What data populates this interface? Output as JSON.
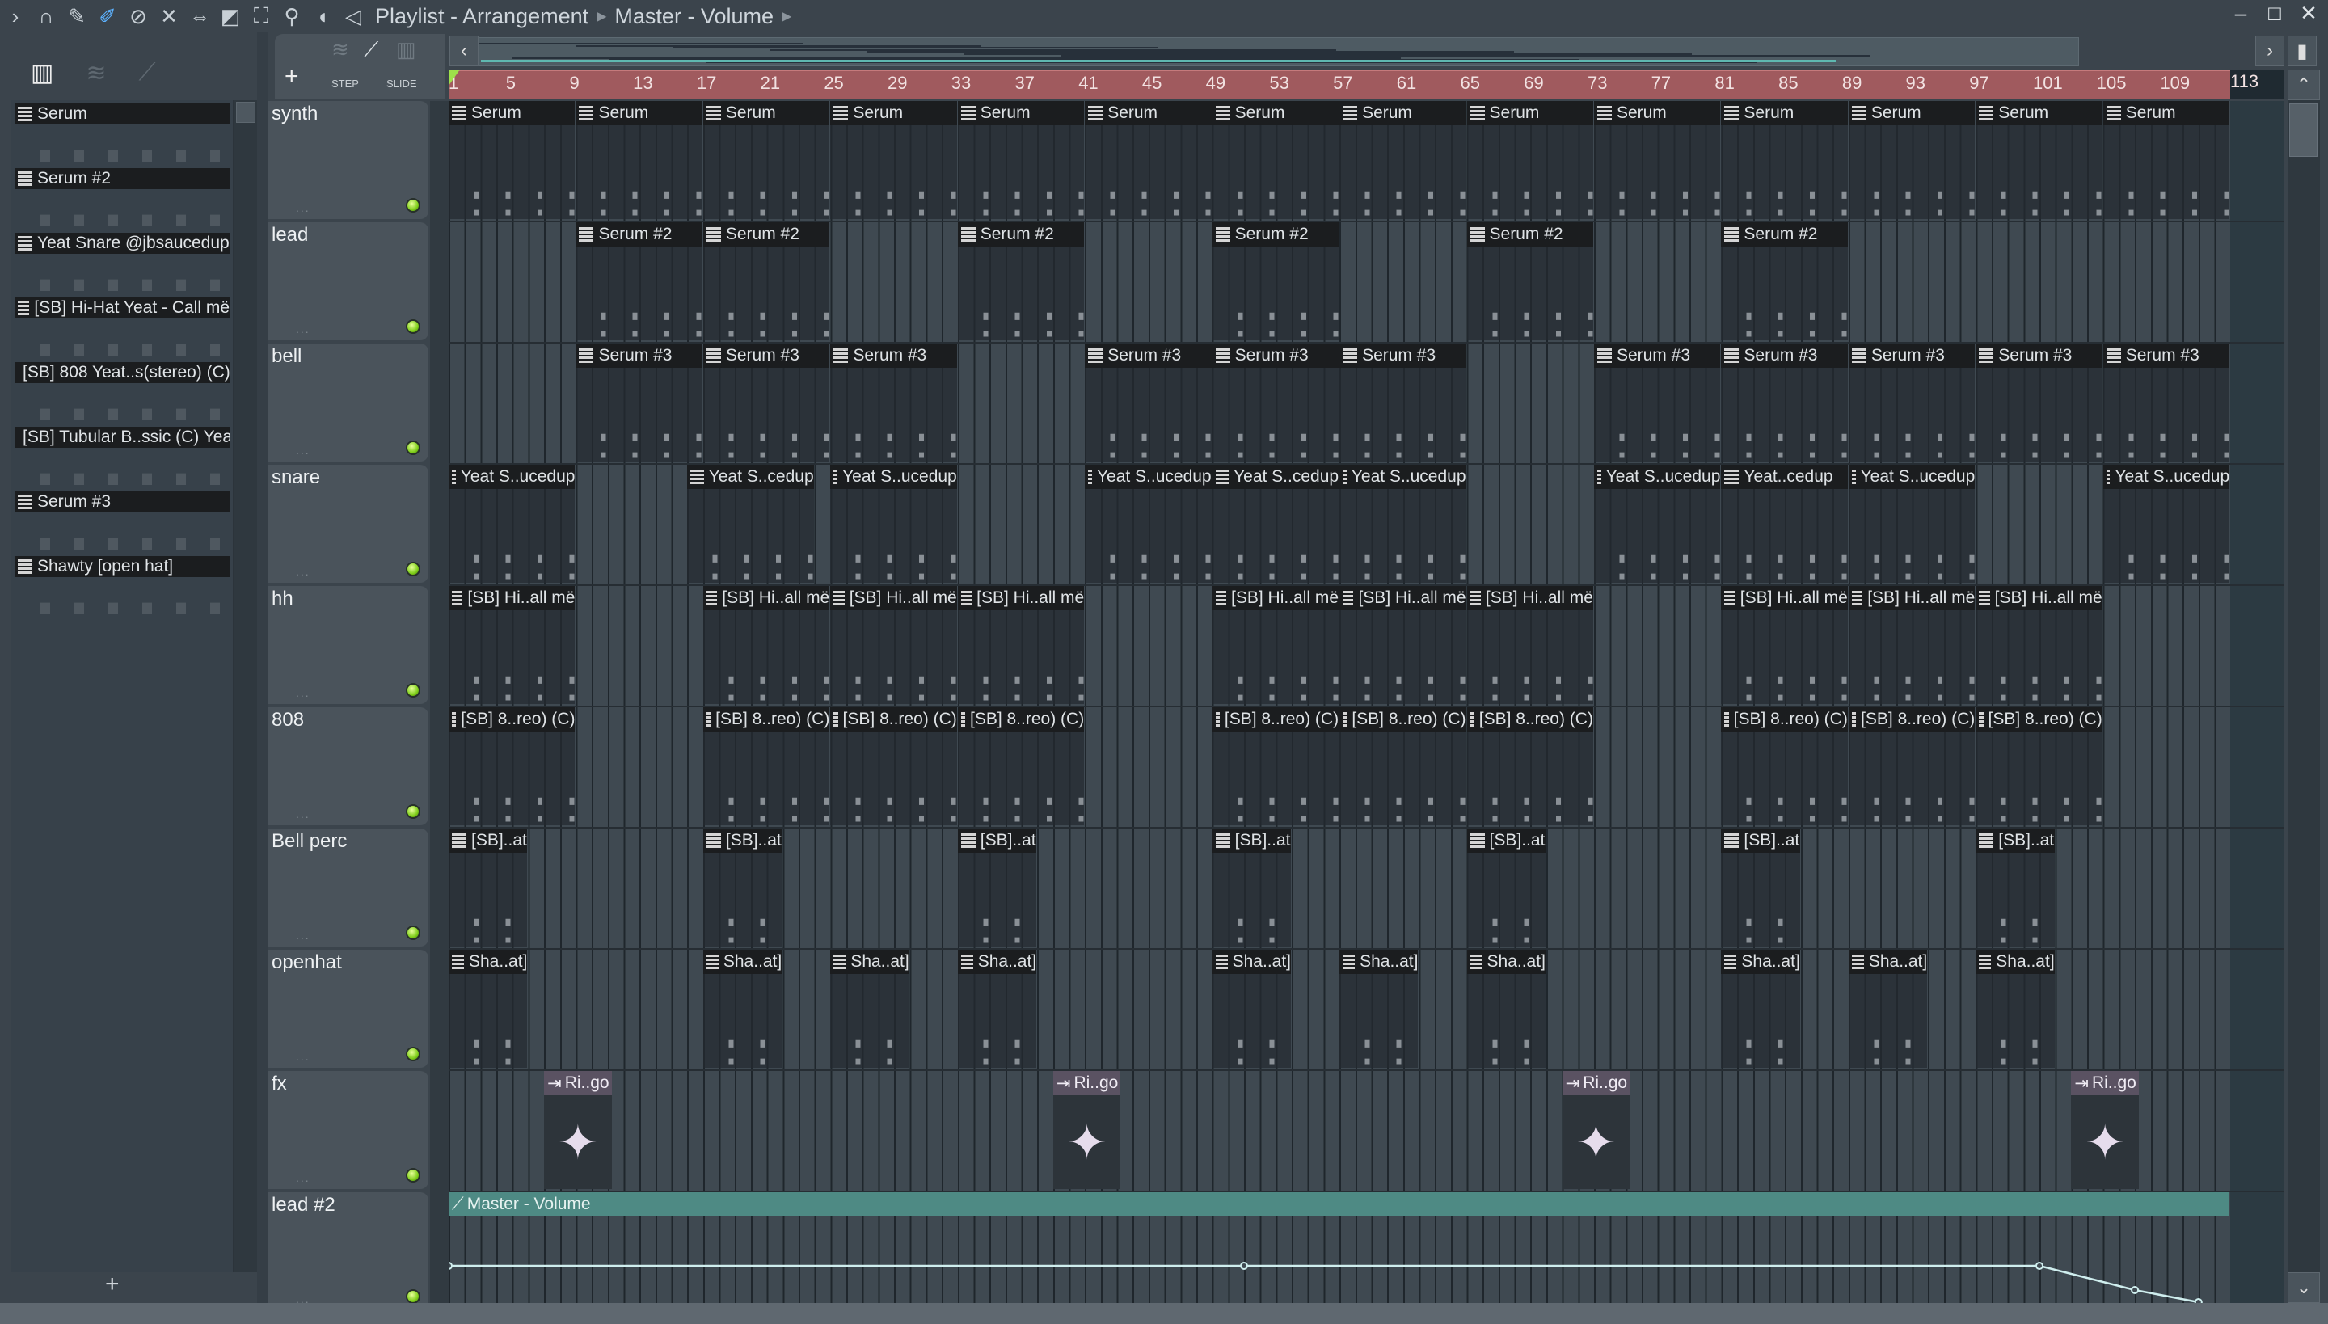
{
  "window": {
    "title": "Playlist - Arrangement",
    "breadcrumb": "Master - Volume",
    "minimize": "–",
    "maximize": "□",
    "close": "✕"
  },
  "toolbar": {
    "icons": [
      "arrow-icon",
      "magnet-icon",
      "pencil-icon",
      "paint-icon",
      "delete-icon",
      "mute-icon",
      "slip-icon",
      "slice-icon",
      "select-icon",
      "zoom-icon",
      "playback-icon",
      "speaker-icon"
    ]
  },
  "track_tools": {
    "add": "+",
    "step": "STEP",
    "slide": "SLIDE"
  },
  "patterns": [
    "Serum",
    "Serum #2",
    "Yeat Snare @jbsaucedup",
    "[SB] Hi-Hat Yeat - Call më",
    "[SB] 808 Yeat..s(stereo) (C)",
    "[SB] Tubular B..ssic (C) Yeat",
    "Serum #3",
    "Shawty [open hat]"
  ],
  "add_pattern": "+",
  "ruler": [
    "1",
    "5",
    "9",
    "13",
    "17",
    "21",
    "25",
    "29",
    "33",
    "37",
    "41",
    "45",
    "49",
    "53",
    "57",
    "61",
    "65",
    "69",
    "73",
    "77",
    "81",
    "85",
    "89",
    "93",
    "97",
    "101",
    "105",
    "109",
    "113"
  ],
  "tracks": [
    {
      "name": "synth",
      "clips": {
        "label": "Serum",
        "starts": [
          1,
          9,
          17,
          25,
          33,
          41,
          49,
          57,
          65,
          73,
          81,
          89,
          97,
          105
        ],
        "len": 8
      }
    },
    {
      "name": "lead",
      "clips": {
        "label": "Serum #2",
        "starts": [
          9,
          17,
          33,
          49,
          65,
          81
        ],
        "len": 8
      }
    },
    {
      "name": "bell",
      "clips": {
        "label": "Serum #3",
        "starts": [
          9,
          17,
          25,
          41,
          49,
          57,
          73,
          81,
          89,
          97,
          105
        ],
        "len": 8
      }
    },
    {
      "name": "snare",
      "clips": {
        "labels": [
          "Yeat S..ucedup",
          "Yeat S..cedup",
          "Yeat S..ucedup",
          "Yeat S..ucedup",
          "Yeat S..cedup",
          "Yeat S..ucedup",
          "Yeat S..ucedup",
          "Yeat..cedup",
          "Yeat S..ucedup",
          "Yeat S..ucedup"
        ],
        "starts": [
          1,
          16,
          25,
          41,
          49,
          57,
          73,
          81,
          89,
          105
        ],
        "len": 8
      }
    },
    {
      "name": "hh",
      "clips": {
        "label": "[SB] Hi..all më",
        "starts": [
          1,
          17,
          25,
          33,
          49,
          57,
          65,
          81,
          89,
          97
        ],
        "len": 8
      }
    },
    {
      "name": "808",
      "clips": {
        "label": "[SB] 8..reo) (C)",
        "starts": [
          1,
          17,
          25,
          33,
          49,
          57,
          65,
          81,
          89,
          97
        ],
        "len": 8
      }
    },
    {
      "name": "Bell perc",
      "clips": {
        "label": "[SB]..at",
        "starts": [
          1,
          17,
          33,
          49,
          65,
          81,
          97
        ],
        "len": 5
      }
    },
    {
      "name": "openhat",
      "clips": {
        "label": "Sha..at]",
        "starts": [
          1,
          17,
          25,
          33,
          49,
          57,
          65,
          81,
          89,
          97
        ],
        "len": 5
      }
    },
    {
      "name": "fx",
      "clips": {
        "label": "Ri..go",
        "starts": [
          7,
          39,
          71,
          103
        ],
        "len": 4.3,
        "type": "audio"
      }
    },
    {
      "name": "lead #2",
      "clips": {
        "label": "Master - Volume",
        "starts": [
          1
        ],
        "len": 112,
        "type": "auto"
      }
    }
  ],
  "automation": {
    "points": [
      [
        1,
        0.55
      ],
      [
        51,
        0.55
      ],
      [
        101,
        0.55
      ],
      [
        107,
        0.85
      ],
      [
        111,
        1.0
      ]
    ]
  },
  "colors": {
    "ruler": "#a05a5e",
    "automation": "#4e8a84",
    "led": "#7fcf1a"
  }
}
